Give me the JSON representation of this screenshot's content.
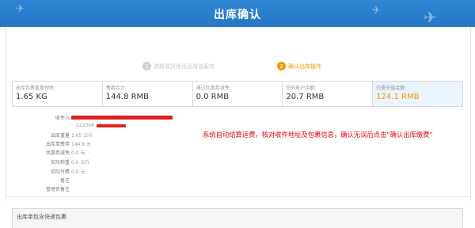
{
  "header": {
    "title": "出库确认"
  },
  "steps": [
    {
      "num": "1",
      "label": "选择收货地址及增值服务"
    },
    {
      "num": "2",
      "label": "确认出库操作"
    }
  ],
  "summary": [
    {
      "label": "出库包裹重量预估:",
      "value": "1.65 KG"
    },
    {
      "label": "费用合计:",
      "value": "144.8 RMB"
    },
    {
      "label": "通过优惠券减免:",
      "value": "0.0 RMB"
    },
    {
      "label": "您的账户余额:",
      "value": "20.7 RMB"
    },
    {
      "label": "仍需充值金额:",
      "value": "124.1 RMB"
    }
  ],
  "details": {
    "recipient_label": "收件人",
    "recipient_line2": "222004 , 1",
    "weight_label": "出库重量",
    "weight_value": "1.65 公斤",
    "fee_label": "出库单费用",
    "fee_value": "144.8 元",
    "discount_label": "优惠券减免",
    "discount_value": "0.0 元",
    "actual_weight_label": "实际称重",
    "actual_weight_value": "0.0 公斤",
    "actual_pay_label": "实际付费",
    "actual_pay_value": "0.0 元",
    "note_label": "备注",
    "admin_note_label": "管理员备注"
  },
  "notice": "系统自动结算运费，核对收件地址及包裹信息，确认无误后点击“确认出库缴费”",
  "package_section": {
    "title": "出库单包含快递包裹"
  },
  "colors": {
    "header_blue": "#2a7fcf",
    "accent_orange": "#f39800",
    "alert_red": "#e60012"
  }
}
